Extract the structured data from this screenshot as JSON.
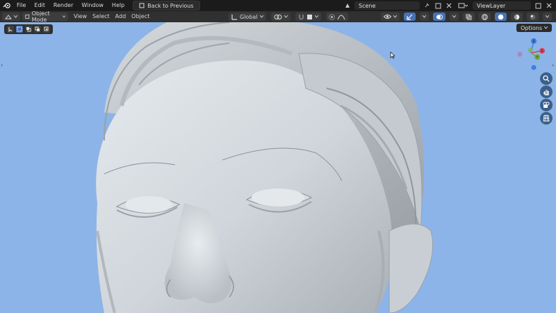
{
  "topbar": {
    "menus": [
      "File",
      "Edit",
      "Render",
      "Window",
      "Help"
    ],
    "back_label": "Back to Previous",
    "scene": "Scene",
    "view_layer": "ViewLayer"
  },
  "header": {
    "mode": "Object Mode",
    "menus": [
      "View",
      "Select",
      "Add",
      "Object"
    ],
    "transform_orientation": "Global",
    "options_label": "Options"
  },
  "gizmo": {
    "axes": [
      "Z",
      "X",
      "Y"
    ],
    "colors": {
      "x": "#d6455c",
      "y": "#6faa3a",
      "z": "#3c7fe0"
    }
  },
  "viewport": {
    "background": "#8cb4e8",
    "object": "head-sculpt"
  }
}
